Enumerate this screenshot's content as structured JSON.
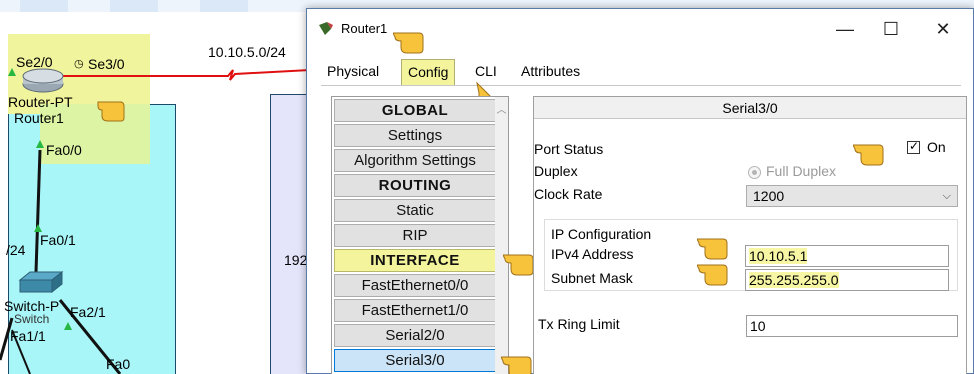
{
  "workspace": {
    "link_label": "10.10.5.0/24",
    "router": {
      "port_left": "Se2/0",
      "port_right": "Se3/0",
      "type": "Router-PT",
      "name": "Router1",
      "port_fa00": "Fa0/0"
    },
    "switch": {
      "port_fa01": "Fa0/1",
      "port_fa21": "Fa2/1",
      "port_fa11": "Fa1/1",
      "port_fa0": "Fa0",
      "name_partial": "Switch-P",
      "name_partial2": "Switch"
    },
    "cut_label_24": "/24",
    "cut_label_192": "192"
  },
  "window": {
    "title": "Router1",
    "minimize": "—",
    "maximize": "☐",
    "close": "✕"
  },
  "tabs": [
    {
      "label": "Physical"
    },
    {
      "label": "Config"
    },
    {
      "label": "CLI"
    },
    {
      "label": "Attributes"
    }
  ],
  "active_tab": "Config",
  "nav": {
    "items": [
      {
        "label": "GLOBAL",
        "kind": "header"
      },
      {
        "label": "Settings",
        "kind": "item"
      },
      {
        "label": "Algorithm Settings",
        "kind": "item"
      },
      {
        "label": "ROUTING",
        "kind": "header"
      },
      {
        "label": "Static",
        "kind": "item"
      },
      {
        "label": "RIP",
        "kind": "item"
      },
      {
        "label": "INTERFACE",
        "kind": "header-highlight"
      },
      {
        "label": "FastEthernet0/0",
        "kind": "item"
      },
      {
        "label": "FastEthernet1/0",
        "kind": "item"
      },
      {
        "label": "Serial2/0",
        "kind": "item"
      },
      {
        "label": "Serial3/0",
        "kind": "selected"
      }
    ]
  },
  "panel": {
    "header": "Serial3/0",
    "port_status_label": "Port Status",
    "port_status_checked": true,
    "port_status_on_label": "On",
    "duplex_label": "Duplex",
    "duplex_value": "Full Duplex",
    "clock_rate_label": "Clock Rate",
    "clock_rate_value": "1200",
    "ip_config_label": "IP Configuration",
    "ipv4_label": "IPv4 Address",
    "ipv4_value": "10.10.5.1",
    "subnet_label": "Subnet Mask",
    "subnet_value": "255.255.255.0",
    "tx_ring_label": "Tx Ring Limit",
    "tx_ring_value": "10"
  },
  "icons": {
    "window_icon": "router-icon",
    "pointer": "pointing-hand-icon"
  },
  "colors": {
    "highlight": "#f4f49c",
    "selected": "#cce4f7",
    "link_red": "#e01010"
  }
}
